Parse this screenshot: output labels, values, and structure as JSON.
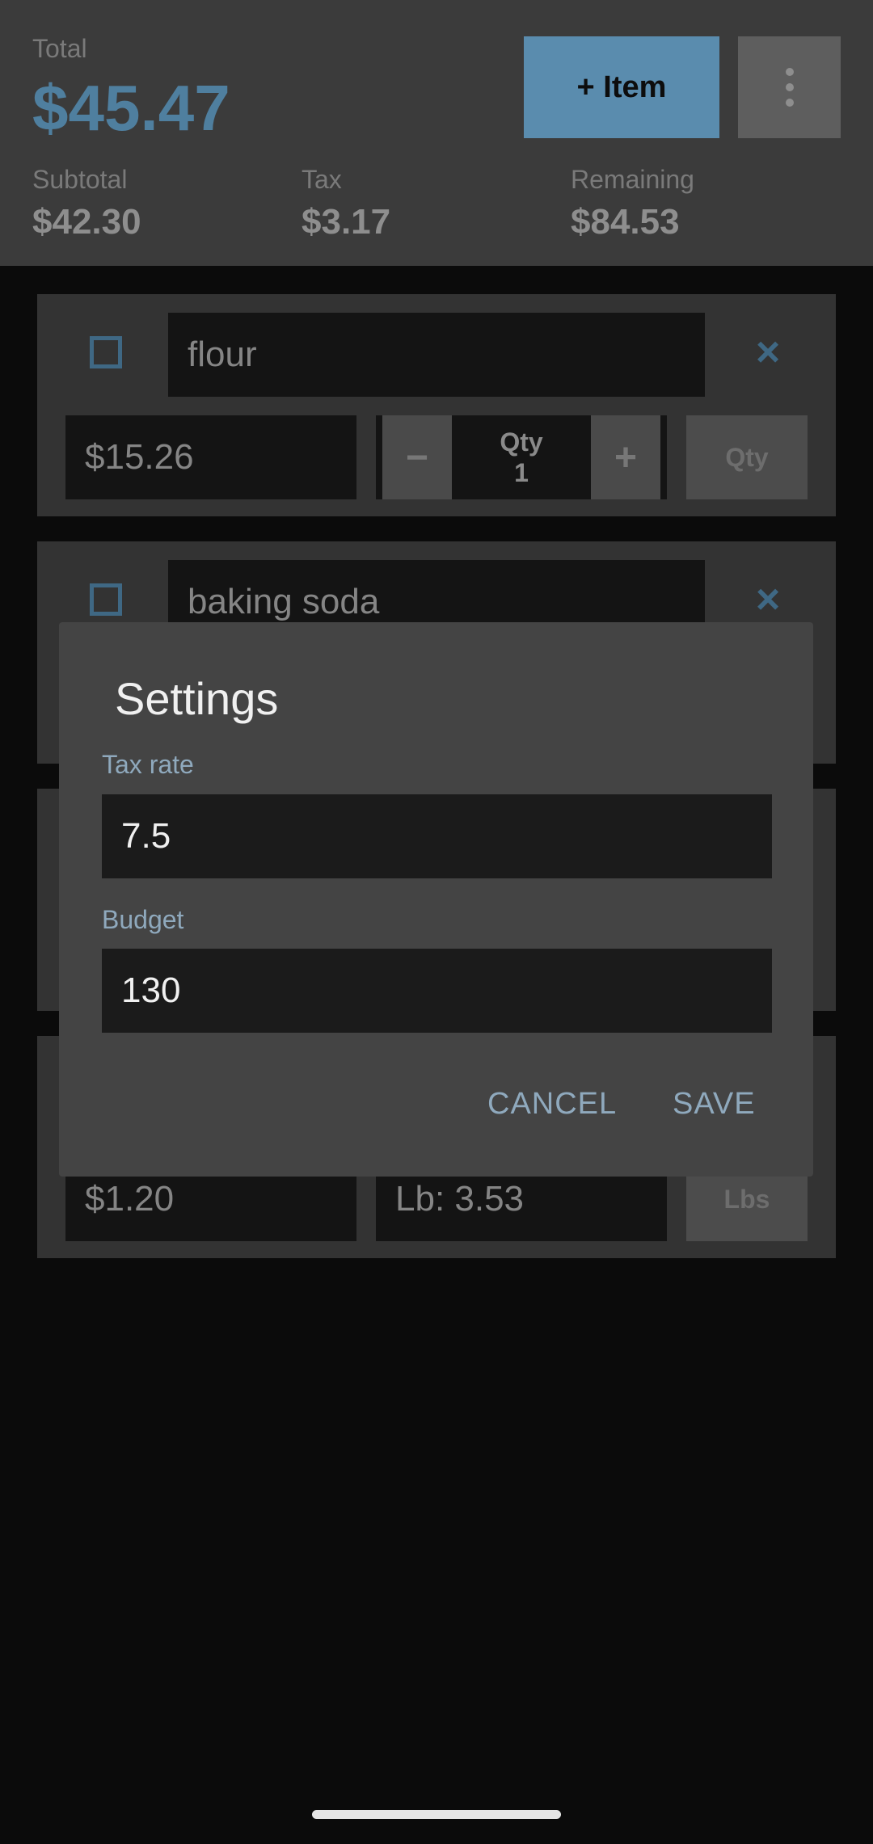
{
  "header": {
    "total_label": "Total",
    "total_value": "$45.47",
    "add_item_label": "+ Item",
    "subtotal_label": "Subtotal",
    "subtotal_value": "$42.30",
    "tax_label": "Tax",
    "tax_value": "$3.17",
    "remaining_label": "Remaining",
    "remaining_value": "$84.53"
  },
  "items": [
    {
      "name": "flour",
      "price": "$15.26",
      "qty_label": "Qty",
      "qty_value": "1",
      "minus": "−",
      "plus": "+",
      "unit_button": "Qty"
    },
    {
      "name": "baking soda"
    },
    {},
    {
      "price": "$1.20",
      "weight_text": "Lb: 3.53",
      "unit_button": "Lbs"
    }
  ],
  "dialog": {
    "title": "Settings",
    "tax_rate_label": "Tax rate",
    "tax_rate_value": "7.5",
    "budget_label": "Budget",
    "budget_value": "130",
    "cancel_label": "CANCEL",
    "save_label": "SAVE"
  },
  "colors": {
    "accent": "#5a8cae",
    "header_bg": "#3b3b3b",
    "dialog_bg": "#444444"
  }
}
